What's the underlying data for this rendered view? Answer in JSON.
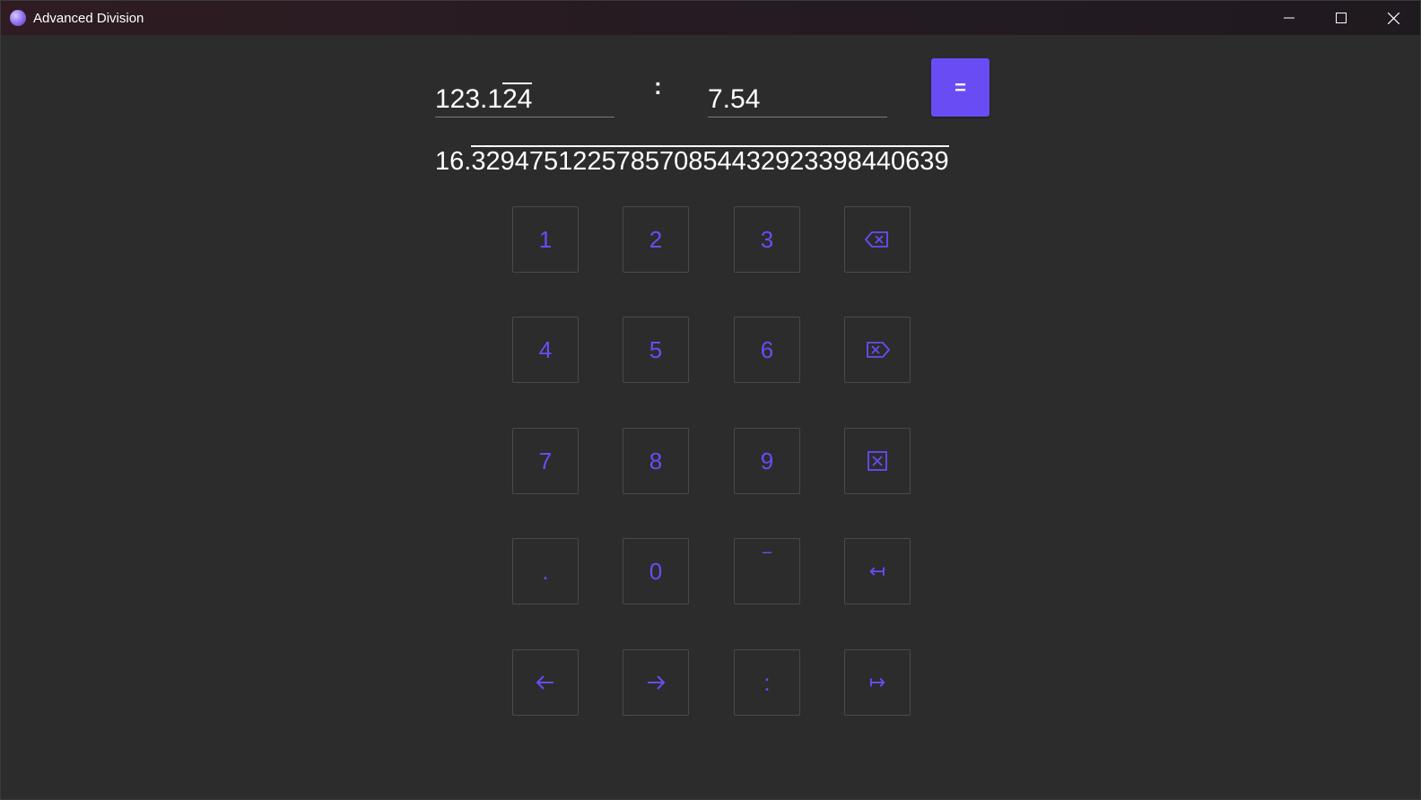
{
  "window": {
    "title": "Advanced Division",
    "controls": {
      "minimize_icon": "minimize-icon",
      "maximize_icon": "maximize-icon",
      "close_icon": "close-icon"
    }
  },
  "colors": {
    "accent": "#6a4cf5",
    "background": "#2c2c2c",
    "text": "#ffffff"
  },
  "calculator": {
    "dividend": {
      "prefix": "123.1",
      "repeating": "24"
    },
    "operator": ":",
    "divisor": {
      "value": "7.54"
    },
    "equals_label": "=",
    "result": {
      "prefix": "16.",
      "repeating": "3294751225785708544329233984406 39"
    }
  },
  "keypad": {
    "keys": [
      {
        "label": "1",
        "name": "key-1"
      },
      {
        "label": "2",
        "name": "key-2"
      },
      {
        "label": "3",
        "name": "key-3"
      },
      {
        "label": "",
        "name": "backspace-key",
        "icon": "backspace-icon"
      },
      {
        "label": "4",
        "name": "key-4"
      },
      {
        "label": "5",
        "name": "key-5"
      },
      {
        "label": "6",
        "name": "key-6"
      },
      {
        "label": "",
        "name": "delete-key",
        "icon": "delete-forward-icon"
      },
      {
        "label": "7",
        "name": "key-7"
      },
      {
        "label": "8",
        "name": "key-8"
      },
      {
        "label": "9",
        "name": "key-9"
      },
      {
        "label": "",
        "name": "clear-key",
        "icon": "clear-box-icon"
      },
      {
        "label": ".",
        "name": "decimal-point-key"
      },
      {
        "label": "0",
        "name": "key-0"
      },
      {
        "label": "‾",
        "name": "repeat-bar-key"
      },
      {
        "label": "↤",
        "name": "move-to-start-key",
        "icon": "arrow-to-start-icon"
      },
      {
        "label": "",
        "name": "move-left-key",
        "icon": "arrow-left-icon"
      },
      {
        "label": "",
        "name": "move-right-key",
        "icon": "arrow-right-icon"
      },
      {
        "label": ":",
        "name": "divide-key"
      },
      {
        "label": "↦",
        "name": "move-to-end-key",
        "icon": "arrow-to-end-icon"
      }
    ]
  }
}
